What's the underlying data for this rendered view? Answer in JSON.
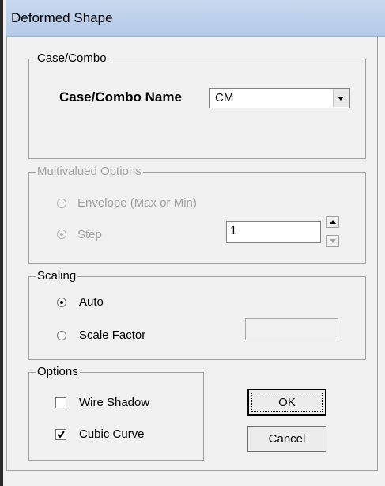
{
  "window": {
    "title": "Deformed Shape"
  },
  "case_combo": {
    "legend": "Case/Combo",
    "name_label": "Case/Combo Name",
    "selected_value": "CM"
  },
  "multivalued": {
    "legend": "Multivalued Options",
    "envelope_label": "Envelope (Max or Min)",
    "step_label": "Step",
    "step_value": "1"
  },
  "scaling": {
    "legend": "Scaling",
    "auto_label": "Auto",
    "scale_factor_label": "Scale Factor",
    "scale_factor_value": ""
  },
  "options": {
    "legend": "Options",
    "wire_shadow_label": "Wire Shadow",
    "wire_shadow_checked": false,
    "cubic_curve_label": "Cubic Curve",
    "cubic_curve_checked": true
  },
  "buttons": {
    "ok_label": "OK",
    "cancel_label": "Cancel"
  }
}
